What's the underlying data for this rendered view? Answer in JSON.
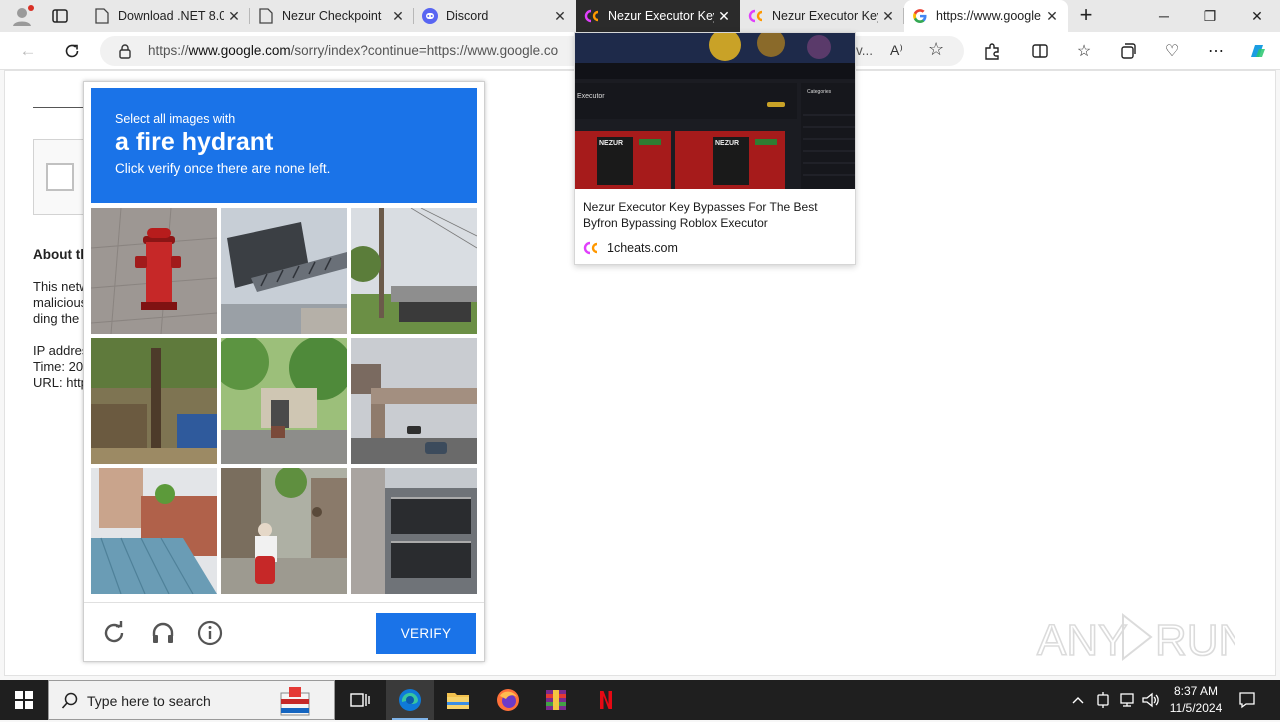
{
  "tabs": [
    {
      "label": "Download .NET 8.0",
      "close": "✕"
    },
    {
      "label": "Nezur Checkpoint",
      "close": "✕"
    },
    {
      "label": "Discord",
      "close": "✕"
    },
    {
      "label": "Nezur Executor Key",
      "close": "✕"
    },
    {
      "label": "Nezur Executor Key",
      "close": "✕"
    },
    {
      "label": "https://www.google",
      "close": "✕"
    }
  ],
  "new_tab": "+",
  "window": {
    "minimize": "─",
    "restore": "❐",
    "close": "✕"
  },
  "address": {
    "prefix": "https://",
    "host": "www.google.com",
    "path": "/sorry/index?continue=https://www.google.co",
    "tail": "v..."
  },
  "page": {
    "about_heading": "About th",
    "lines": [
      "This netw",
      "malicious",
      "ding the"
    ],
    "info": [
      "IP addres",
      "Time: 20",
      "URL: http"
    ]
  },
  "captcha": {
    "select_text": "Select all images with",
    "object": "a fire hydrant",
    "instruction": "Click verify once there are none left.",
    "verify_label": "VERIFY"
  },
  "hover_card": {
    "title": "Nezur Executor Key Bypasses For The Best Byfron Bypassing Roblox Executor",
    "domain": "1cheats.com",
    "thumb_heading": "Executor",
    "thumb_categories": "Categories",
    "thumb_brand": "NEZUR"
  },
  "watermark": "ANY RUN",
  "taskbar": {
    "search_placeholder": "Type here to search",
    "time": "8:37 AM",
    "date": "11/5/2024"
  },
  "colors": {
    "accent": "#1a73e8",
    "tab_active": "#ffffff",
    "taskbar": "#1f1f1f"
  }
}
